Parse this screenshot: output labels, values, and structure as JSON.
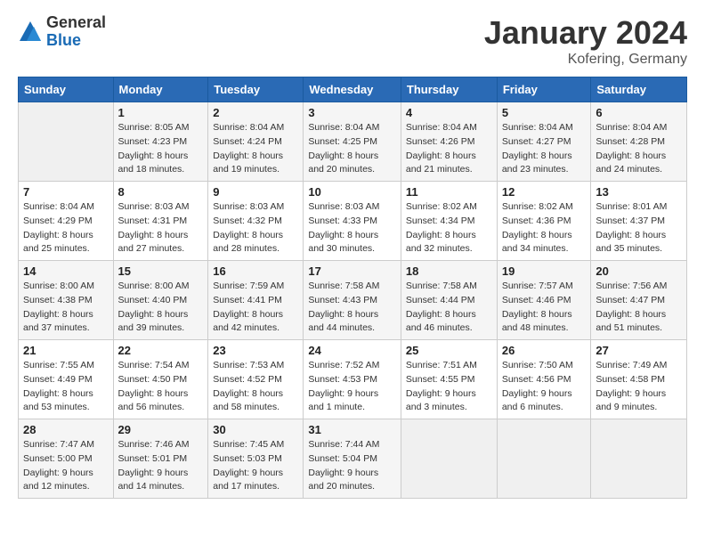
{
  "header": {
    "logo_general": "General",
    "logo_blue": "Blue",
    "month_title": "January 2024",
    "location": "Kofering, Germany"
  },
  "weekdays": [
    "Sunday",
    "Monday",
    "Tuesday",
    "Wednesday",
    "Thursday",
    "Friday",
    "Saturday"
  ],
  "weeks": [
    [
      {
        "day": "",
        "sunrise": "",
        "sunset": "",
        "daylight": ""
      },
      {
        "day": "1",
        "sunrise": "Sunrise: 8:05 AM",
        "sunset": "Sunset: 4:23 PM",
        "daylight": "Daylight: 8 hours and 18 minutes."
      },
      {
        "day": "2",
        "sunrise": "Sunrise: 8:04 AM",
        "sunset": "Sunset: 4:24 PM",
        "daylight": "Daylight: 8 hours and 19 minutes."
      },
      {
        "day": "3",
        "sunrise": "Sunrise: 8:04 AM",
        "sunset": "Sunset: 4:25 PM",
        "daylight": "Daylight: 8 hours and 20 minutes."
      },
      {
        "day": "4",
        "sunrise": "Sunrise: 8:04 AM",
        "sunset": "Sunset: 4:26 PM",
        "daylight": "Daylight: 8 hours and 21 minutes."
      },
      {
        "day": "5",
        "sunrise": "Sunrise: 8:04 AM",
        "sunset": "Sunset: 4:27 PM",
        "daylight": "Daylight: 8 hours and 23 minutes."
      },
      {
        "day": "6",
        "sunrise": "Sunrise: 8:04 AM",
        "sunset": "Sunset: 4:28 PM",
        "daylight": "Daylight: 8 hours and 24 minutes."
      }
    ],
    [
      {
        "day": "7",
        "sunrise": "Sunrise: 8:04 AM",
        "sunset": "Sunset: 4:29 PM",
        "daylight": "Daylight: 8 hours and 25 minutes."
      },
      {
        "day": "8",
        "sunrise": "Sunrise: 8:03 AM",
        "sunset": "Sunset: 4:31 PM",
        "daylight": "Daylight: 8 hours and 27 minutes."
      },
      {
        "day": "9",
        "sunrise": "Sunrise: 8:03 AM",
        "sunset": "Sunset: 4:32 PM",
        "daylight": "Daylight: 8 hours and 28 minutes."
      },
      {
        "day": "10",
        "sunrise": "Sunrise: 8:03 AM",
        "sunset": "Sunset: 4:33 PM",
        "daylight": "Daylight: 8 hours and 30 minutes."
      },
      {
        "day": "11",
        "sunrise": "Sunrise: 8:02 AM",
        "sunset": "Sunset: 4:34 PM",
        "daylight": "Daylight: 8 hours and 32 minutes."
      },
      {
        "day": "12",
        "sunrise": "Sunrise: 8:02 AM",
        "sunset": "Sunset: 4:36 PM",
        "daylight": "Daylight: 8 hours and 34 minutes."
      },
      {
        "day": "13",
        "sunrise": "Sunrise: 8:01 AM",
        "sunset": "Sunset: 4:37 PM",
        "daylight": "Daylight: 8 hours and 35 minutes."
      }
    ],
    [
      {
        "day": "14",
        "sunrise": "Sunrise: 8:00 AM",
        "sunset": "Sunset: 4:38 PM",
        "daylight": "Daylight: 8 hours and 37 minutes."
      },
      {
        "day": "15",
        "sunrise": "Sunrise: 8:00 AM",
        "sunset": "Sunset: 4:40 PM",
        "daylight": "Daylight: 8 hours and 39 minutes."
      },
      {
        "day": "16",
        "sunrise": "Sunrise: 7:59 AM",
        "sunset": "Sunset: 4:41 PM",
        "daylight": "Daylight: 8 hours and 42 minutes."
      },
      {
        "day": "17",
        "sunrise": "Sunrise: 7:58 AM",
        "sunset": "Sunset: 4:43 PM",
        "daylight": "Daylight: 8 hours and 44 minutes."
      },
      {
        "day": "18",
        "sunrise": "Sunrise: 7:58 AM",
        "sunset": "Sunset: 4:44 PM",
        "daylight": "Daylight: 8 hours and 46 minutes."
      },
      {
        "day": "19",
        "sunrise": "Sunrise: 7:57 AM",
        "sunset": "Sunset: 4:46 PM",
        "daylight": "Daylight: 8 hours and 48 minutes."
      },
      {
        "day": "20",
        "sunrise": "Sunrise: 7:56 AM",
        "sunset": "Sunset: 4:47 PM",
        "daylight": "Daylight: 8 hours and 51 minutes."
      }
    ],
    [
      {
        "day": "21",
        "sunrise": "Sunrise: 7:55 AM",
        "sunset": "Sunset: 4:49 PM",
        "daylight": "Daylight: 8 hours and 53 minutes."
      },
      {
        "day": "22",
        "sunrise": "Sunrise: 7:54 AM",
        "sunset": "Sunset: 4:50 PM",
        "daylight": "Daylight: 8 hours and 56 minutes."
      },
      {
        "day": "23",
        "sunrise": "Sunrise: 7:53 AM",
        "sunset": "Sunset: 4:52 PM",
        "daylight": "Daylight: 8 hours and 58 minutes."
      },
      {
        "day": "24",
        "sunrise": "Sunrise: 7:52 AM",
        "sunset": "Sunset: 4:53 PM",
        "daylight": "Daylight: 9 hours and 1 minute."
      },
      {
        "day": "25",
        "sunrise": "Sunrise: 7:51 AM",
        "sunset": "Sunset: 4:55 PM",
        "daylight": "Daylight: 9 hours and 3 minutes."
      },
      {
        "day": "26",
        "sunrise": "Sunrise: 7:50 AM",
        "sunset": "Sunset: 4:56 PM",
        "daylight": "Daylight: 9 hours and 6 minutes."
      },
      {
        "day": "27",
        "sunrise": "Sunrise: 7:49 AM",
        "sunset": "Sunset: 4:58 PM",
        "daylight": "Daylight: 9 hours and 9 minutes."
      }
    ],
    [
      {
        "day": "28",
        "sunrise": "Sunrise: 7:47 AM",
        "sunset": "Sunset: 5:00 PM",
        "daylight": "Daylight: 9 hours and 12 minutes."
      },
      {
        "day": "29",
        "sunrise": "Sunrise: 7:46 AM",
        "sunset": "Sunset: 5:01 PM",
        "daylight": "Daylight: 9 hours and 14 minutes."
      },
      {
        "day": "30",
        "sunrise": "Sunrise: 7:45 AM",
        "sunset": "Sunset: 5:03 PM",
        "daylight": "Daylight: 9 hours and 17 minutes."
      },
      {
        "day": "31",
        "sunrise": "Sunrise: 7:44 AM",
        "sunset": "Sunset: 5:04 PM",
        "daylight": "Daylight: 9 hours and 20 minutes."
      },
      {
        "day": "",
        "sunrise": "",
        "sunset": "",
        "daylight": ""
      },
      {
        "day": "",
        "sunrise": "",
        "sunset": "",
        "daylight": ""
      },
      {
        "day": "",
        "sunrise": "",
        "sunset": "",
        "daylight": ""
      }
    ]
  ]
}
